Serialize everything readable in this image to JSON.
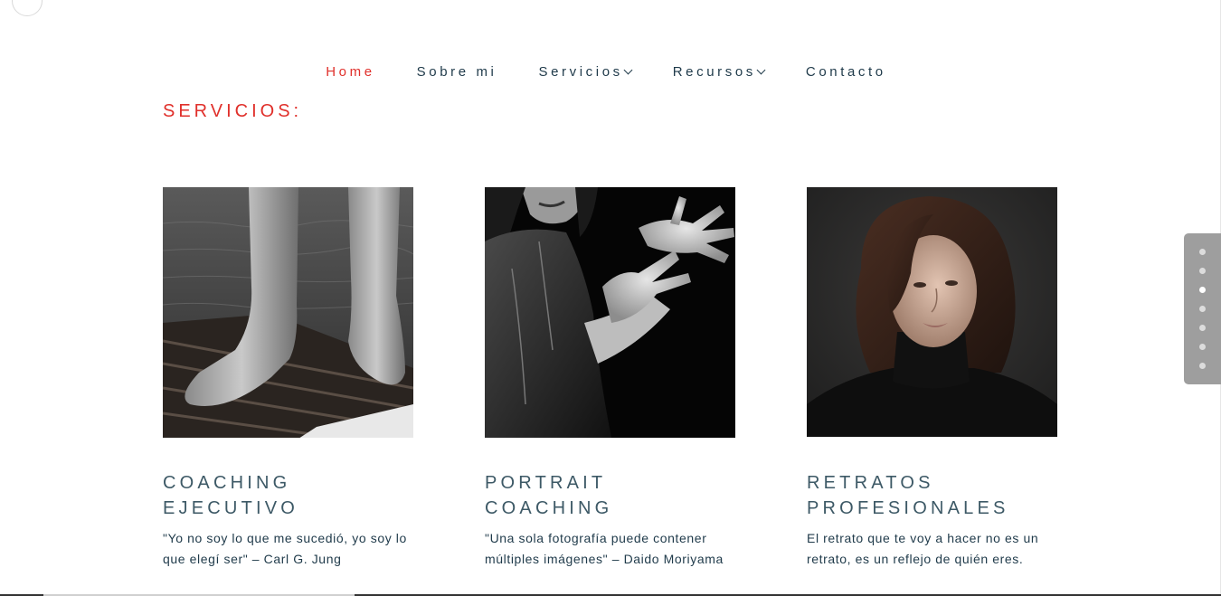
{
  "nav": {
    "items": [
      {
        "label": "Home",
        "active": true,
        "has_dropdown": false
      },
      {
        "label": "Sobre mi",
        "active": false,
        "has_dropdown": false
      },
      {
        "label": "Servicios",
        "active": false,
        "has_dropdown": true
      },
      {
        "label": "Recursos",
        "active": false,
        "has_dropdown": true
      },
      {
        "label": "Contacto",
        "active": false,
        "has_dropdown": false
      }
    ]
  },
  "section": {
    "title": "SERVICIOS:"
  },
  "cards": [
    {
      "title_line1": "COACHING",
      "title_line2": "EJECUTIVO",
      "description": "\"Yo no soy lo que me sucedió, yo soy lo que elegí ser\" – Carl G. Jung"
    },
    {
      "title_line1": "PORTRAIT",
      "title_line2": "COACHING",
      "description": "\"Una sola fotografía puede contener múltiples imágenes\" – Daido Moriyama"
    },
    {
      "title_line1": "RETRATOS",
      "title_line2": "PROFESIONALES",
      "description": "El retrato que te voy a hacer no es un retrato, es un reflejo de quién eres."
    }
  ],
  "dot_nav": {
    "count": 7,
    "active_index": 2
  },
  "colors": {
    "accent": "#e0302b",
    "nav_text": "#1f3a4a",
    "title_text": "#3d5966",
    "dot_panel": "#9e9e9e"
  }
}
